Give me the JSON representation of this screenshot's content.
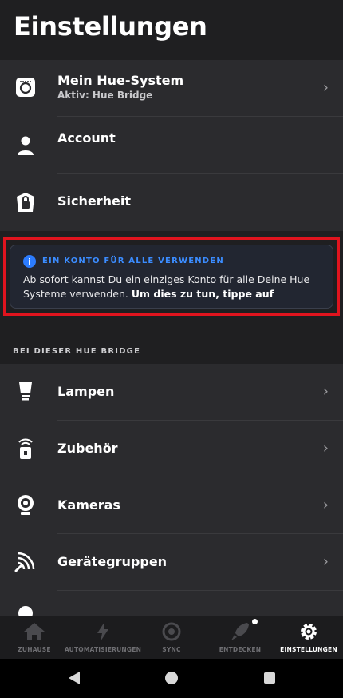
{
  "page": {
    "title": "Einstellungen"
  },
  "top_group": {
    "hue_system": {
      "label": "Mein Hue-System",
      "sublabel": "Aktiv: Hue Bridge",
      "icon": "bridge-icon"
    },
    "account": {
      "label": "Account",
      "icon": "person-icon"
    },
    "security": {
      "label": "Sicherheit",
      "icon": "shield-icon"
    }
  },
  "banner": {
    "headline": "EIN KONTO FÜR ALLE VERWENDEN",
    "body": "Ab sofort kannst Du ein einziges Konto für alle Deine Hue Systeme verwenden.",
    "cta": "Um dies zu tun, tippe auf",
    "accent": "#2c7cff",
    "highlight": "#e0141e"
  },
  "bridge_section": {
    "header": "BEI DIESER HUE BRIDGE",
    "items": [
      {
        "label": "Lampen",
        "icon": "bulb-icon"
      },
      {
        "label": "Zubehör",
        "icon": "switch-icon"
      },
      {
        "label": "Kameras",
        "icon": "camera-icon"
      },
      {
        "label": "Gerätegruppen",
        "icon": "signal-icon"
      }
    ]
  },
  "tabbar": {
    "tabs": [
      {
        "label": "ZUHAUSE",
        "icon": "home-icon"
      },
      {
        "label": "AUTOMATISIERUNGEN",
        "icon": "bolt-icon"
      },
      {
        "label": "SYNC",
        "icon": "sync-icon"
      },
      {
        "label": "ENTDECKEN",
        "icon": "rocket-icon"
      },
      {
        "label": "EINSTELLUNGEN",
        "icon": "gear-icon",
        "active": true
      }
    ]
  },
  "navbar": {
    "back": "back-icon",
    "home": "home-circle-icon",
    "recents": "recents-icon"
  }
}
